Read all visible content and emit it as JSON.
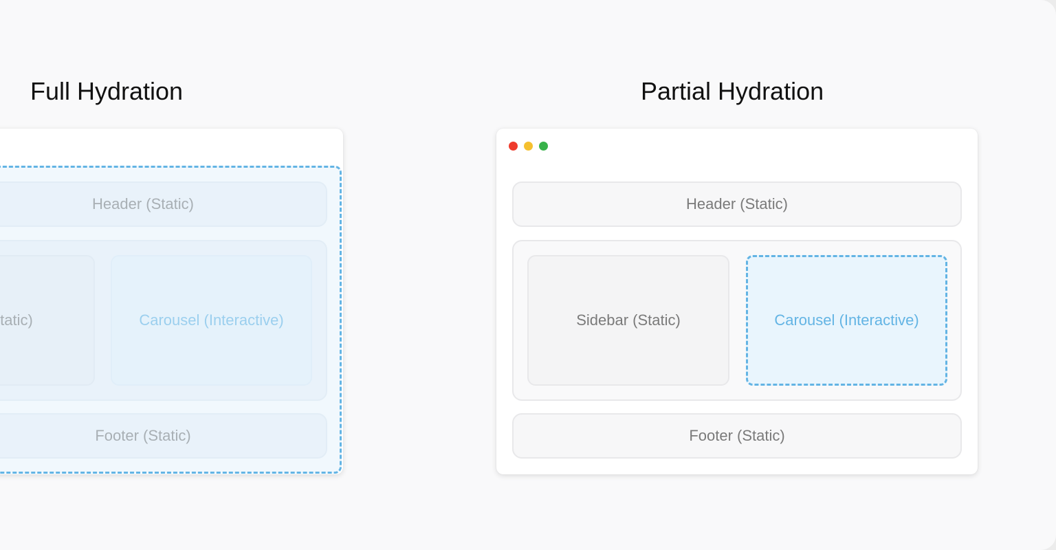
{
  "titles": {
    "full": "Full Hydration",
    "partial": "Partial Hydration"
  },
  "full": {
    "header": "Header (Static)",
    "sidebar": "Sidebar (Static)",
    "carousel": "Carousel (Interactive)",
    "footer": "Footer (Static)"
  },
  "partial": {
    "header": "Header (Static)",
    "sidebar": "Sidebar (Static)",
    "carousel": "Carousel (Interactive)",
    "footer": "Footer (Static)"
  },
  "colors": {
    "interactive_accent": "#63b4e4",
    "static_text": "#7a7a7a",
    "window_dot_red": "#ef3b2c",
    "window_dot_yellow": "#f5c02f",
    "window_dot_green": "#38b24a"
  }
}
